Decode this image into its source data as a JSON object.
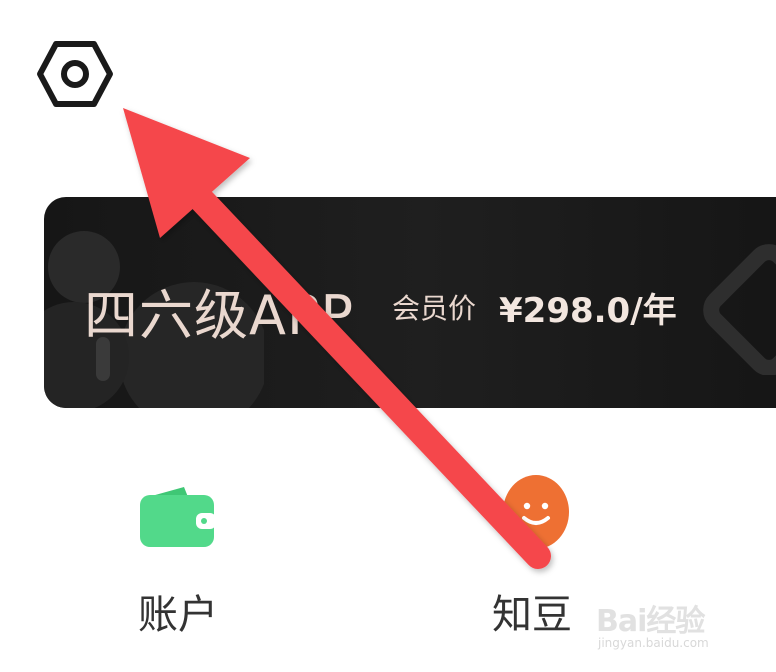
{
  "header": {
    "settings_icon": "settings-hexagon-icon"
  },
  "banner": {
    "title": "四六级APP",
    "member_label": "会员价",
    "price": "¥298.0/年",
    "colors": {
      "background": "#1a1a1a",
      "text": "#ead8cf"
    }
  },
  "entries": [
    {
      "label": "账户",
      "icon": "wallet-icon",
      "color": "#4fd686"
    },
    {
      "label": "知豆",
      "icon": "bean-face-icon",
      "color": "#ee7033"
    }
  ],
  "annotation": {
    "arrow_color": "#f5474b",
    "watermark": {
      "main": "Bai经验",
      "sub": "jingyan.baidu.com"
    }
  }
}
